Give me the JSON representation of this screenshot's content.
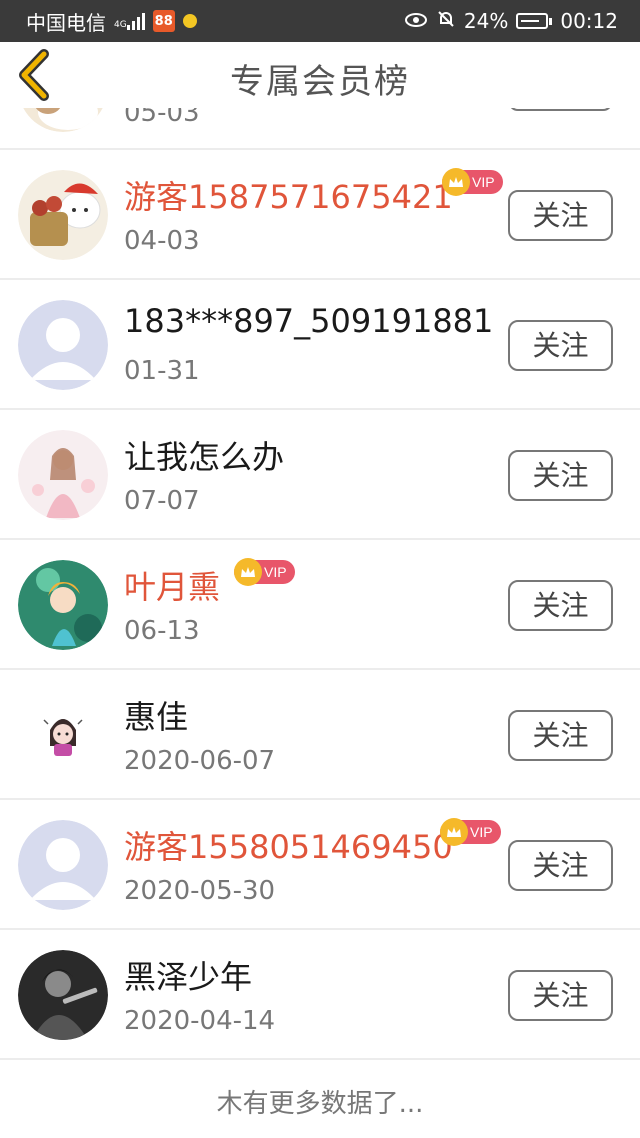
{
  "status_bar": {
    "carrier": "中国电信",
    "network": "4G",
    "app_badge": "88",
    "battery": "24%",
    "time": "00:12"
  },
  "header": {
    "title": "专属会员榜"
  },
  "follow_label": "关注",
  "vip_label": "VIP",
  "members": [
    {
      "name": "",
      "date": "05-03",
      "vip": false,
      "avatar": "cat-avatar"
    },
    {
      "name": "游客1587571675421",
      "date": "04-03",
      "vip": true,
      "avatar": "cat-avatar"
    },
    {
      "name": "183***897_509191881",
      "date": "01-31",
      "vip": false,
      "avatar": "default-avatar"
    },
    {
      "name": "让我怎么办",
      "date": "07-07",
      "vip": false,
      "avatar": "anime-girl-pink-avatar"
    },
    {
      "name": "叶月熏",
      "date": "06-13",
      "vip": true,
      "avatar": "anime-girl-green-avatar"
    },
    {
      "name": "惠佳",
      "date": "2020-06-07",
      "vip": false,
      "avatar": "cartoon-girl-avatar"
    },
    {
      "name": "游客1558051469450",
      "date": "2020-05-30",
      "vip": true,
      "avatar": "default-avatar"
    },
    {
      "name": "黑泽少年",
      "date": "2020-04-14",
      "vip": false,
      "avatar": "dark-figure-avatar"
    }
  ],
  "footer": {
    "no_more": "木有更多数据了..."
  },
  "colors": {
    "status_bar_bg": "#3a3a3a",
    "vip_name": "#e0553a",
    "vip_badge": "#e8566a",
    "crown": "#f5b92a",
    "back_arrow": "#f0b400"
  }
}
